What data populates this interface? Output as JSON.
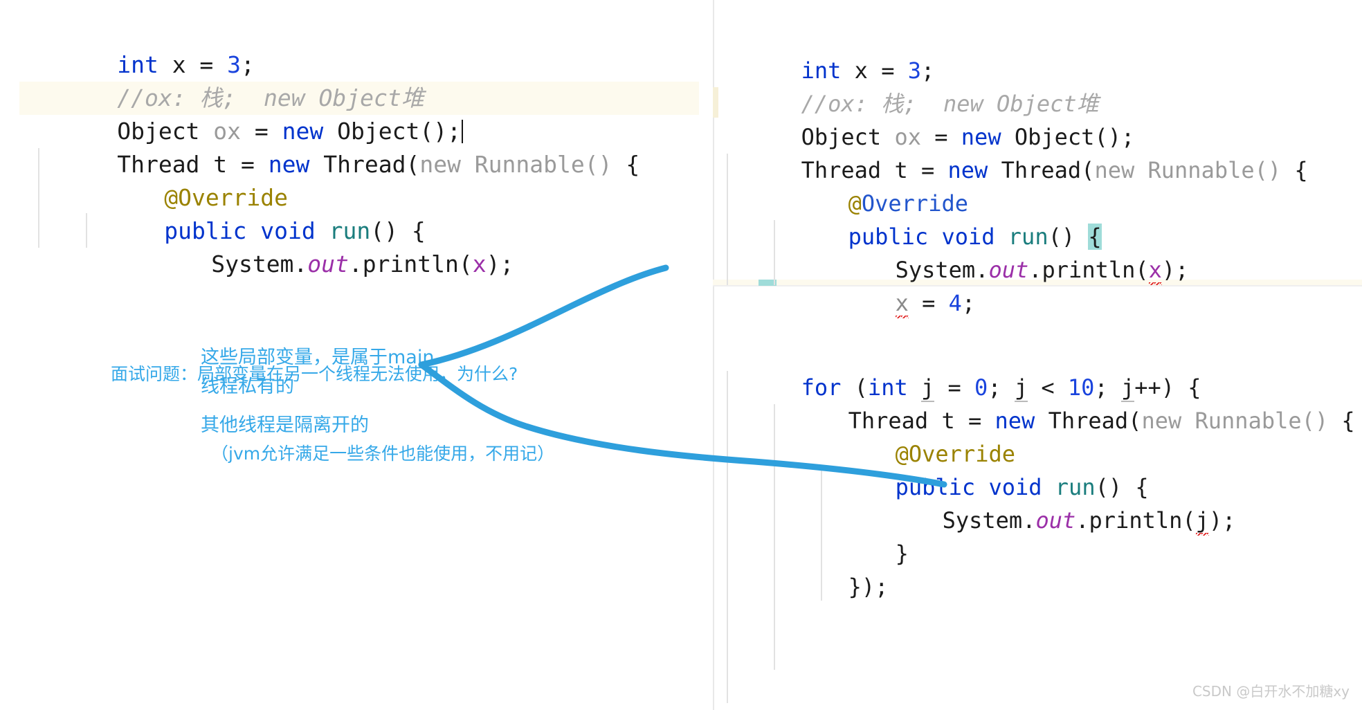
{
  "editor_left": {
    "lines": [
      {
        "indent": 0,
        "tokens": [
          {
            "t": "int",
            "c": "kw"
          },
          {
            "t": " x = ",
            "c": "plain"
          },
          {
            "t": "3",
            "c": "num"
          },
          {
            "t": ";",
            "c": "plain"
          }
        ]
      },
      {
        "indent": 0,
        "tokens": [
          {
            "t": "//ox: 栈;  new Object堆",
            "c": "cmt"
          }
        ]
      },
      {
        "indent": 0,
        "highlight": true,
        "caret": true,
        "tokens": [
          {
            "t": "Object ",
            "c": "plain"
          },
          {
            "t": "ox",
            "c": "gray"
          },
          {
            "t": " = ",
            "c": "plain"
          },
          {
            "t": "new",
            "c": "kw"
          },
          {
            "t": " Object();",
            "c": "plain"
          }
        ]
      },
      {
        "indent": 0,
        "tokens": [
          {
            "t": "Thread t = ",
            "c": "plain"
          },
          {
            "t": "new",
            "c": "kw"
          },
          {
            "t": " Thread(",
            "c": "plain"
          },
          {
            "t": "new Runnable()",
            "c": "gray"
          },
          {
            "t": " {",
            "c": "plain"
          }
        ]
      },
      {
        "indent": 1,
        "tokens": [
          {
            "t": "@Override",
            "c": "ann"
          }
        ]
      },
      {
        "indent": 1,
        "tokens": [
          {
            "t": "public void ",
            "c": "kw"
          },
          {
            "t": "run",
            "c": "meth"
          },
          {
            "t": "() {",
            "c": "plain"
          }
        ]
      },
      {
        "indent": 2,
        "tokens": [
          {
            "t": "System.",
            "c": "plain"
          },
          {
            "t": "out",
            "c": "fld"
          },
          {
            "t": ".println(",
            "c": "plain"
          },
          {
            "t": "x",
            "c": "var"
          },
          {
            "t": ");",
            "c": "plain"
          }
        ]
      }
    ]
  },
  "editor_right": {
    "lines": [
      {
        "indent": 0,
        "tokens": [
          {
            "t": "int",
            "c": "kw"
          },
          {
            "t": " x = ",
            "c": "plain"
          },
          {
            "t": "3",
            "c": "num"
          },
          {
            "t": ";",
            "c": "plain"
          }
        ]
      },
      {
        "indent": 0,
        "tokens": [
          {
            "t": "//ox: 栈;  new Object堆",
            "c": "cmt"
          }
        ]
      },
      {
        "indent": 0,
        "marker": true,
        "tokens": [
          {
            "t": "Object ",
            "c": "plain"
          },
          {
            "t": "ox",
            "c": "gray"
          },
          {
            "t": " = ",
            "c": "plain"
          },
          {
            "t": "new",
            "c": "kw"
          },
          {
            "t": " Object();",
            "c": "plain"
          }
        ]
      },
      {
        "indent": 0,
        "tokens": [
          {
            "t": "Thread t = ",
            "c": "plain"
          },
          {
            "t": "new",
            "c": "kw"
          },
          {
            "t": " Thread(",
            "c": "plain"
          },
          {
            "t": "new Runnable()",
            "c": "gray"
          },
          {
            "t": " {",
            "c": "plain"
          }
        ]
      },
      {
        "indent": 1,
        "tokens": [
          {
            "t": "@",
            "c": "ann"
          },
          {
            "t": "Override",
            "c": "annb"
          }
        ]
      },
      {
        "indent": 1,
        "tokens": [
          {
            "t": "public void ",
            "c": "kw"
          },
          {
            "t": "run",
            "c": "meth"
          },
          {
            "t": "() ",
            "c": "plain"
          },
          {
            "t": "{",
            "c": "brace-hl"
          }
        ]
      },
      {
        "indent": 2,
        "tokens": [
          {
            "t": "System.",
            "c": "plain"
          },
          {
            "t": "out",
            "c": "fld"
          },
          {
            "t": ".println(",
            "c": "plain"
          },
          {
            "t": "x",
            "c": "var sq"
          },
          {
            "t": ");",
            "c": "plain"
          }
        ]
      },
      {
        "indent": 2,
        "tokens": [
          {
            "t": "x",
            "c": "errv sq"
          },
          {
            "t": " = ",
            "c": "plain"
          },
          {
            "t": "4",
            "c": "num"
          },
          {
            "t": ";",
            "c": "plain"
          }
        ]
      },
      {
        "indent": 0,
        "blank": true,
        "highlight": true,
        "tokens": []
      },
      {
        "indent": 0,
        "blank": true,
        "tokens": []
      },
      {
        "indent": 0,
        "tokens": [
          {
            "t": "for",
            "c": "kw"
          },
          {
            "t": " (",
            "c": "plain"
          },
          {
            "t": "int",
            "c": "kw"
          },
          {
            "t": " ",
            "c": "plain"
          },
          {
            "t": "j",
            "c": "plain und"
          },
          {
            "t": " = ",
            "c": "plain"
          },
          {
            "t": "0",
            "c": "num"
          },
          {
            "t": "; ",
            "c": "plain"
          },
          {
            "t": "j",
            "c": "plain und"
          },
          {
            "t": " < ",
            "c": "plain"
          },
          {
            "t": "10",
            "c": "num"
          },
          {
            "t": "; ",
            "c": "plain"
          },
          {
            "t": "j",
            "c": "plain und"
          },
          {
            "t": "++) {",
            "c": "plain"
          }
        ]
      },
      {
        "indent": 1,
        "tokens": [
          {
            "t": "Thread t = ",
            "c": "plain"
          },
          {
            "t": "new",
            "c": "kw"
          },
          {
            "t": " Thread(",
            "c": "plain"
          },
          {
            "t": "new Runnable()",
            "c": "gray"
          },
          {
            "t": " {",
            "c": "plain"
          }
        ]
      },
      {
        "indent": 2,
        "tokens": [
          {
            "t": "@Override",
            "c": "ann"
          }
        ]
      },
      {
        "indent": 2,
        "tokens": [
          {
            "t": "public void ",
            "c": "kw"
          },
          {
            "t": "run",
            "c": "meth"
          },
          {
            "t": "() {",
            "c": "plain"
          }
        ]
      },
      {
        "indent": 3,
        "tokens": [
          {
            "t": "System.",
            "c": "plain"
          },
          {
            "t": "out",
            "c": "fld"
          },
          {
            "t": ".println(",
            "c": "plain"
          },
          {
            "t": "j",
            "c": "plain sq"
          },
          {
            "t": ");",
            "c": "plain"
          }
        ]
      },
      {
        "indent": 2,
        "tokens": [
          {
            "t": "}",
            "c": "plain"
          }
        ]
      },
      {
        "indent": 1,
        "tokens": [
          {
            "t": "});",
            "c": "plain"
          }
        ]
      }
    ]
  },
  "annotations": {
    "color": "#35a8e8",
    "question": "面试问题：局部变量在另一个线程无法使用，为什么?",
    "note_block_1_line_1": "这些局部变量，是属于main",
    "note_block_1_line_2": "线程私有的",
    "note_block_2_line_1": "其他线程是隔离开的",
    "note_block_2_line_2": "（jvm允许满足一些条件也能使用，不用记）"
  },
  "watermark": {
    "text": "CSDN @白开水不加糖xy"
  }
}
